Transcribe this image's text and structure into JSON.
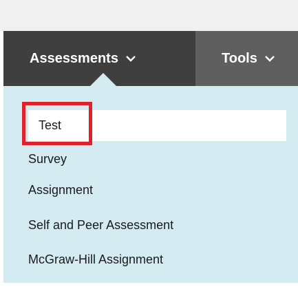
{
  "menubar": {
    "tabs": [
      {
        "label": "Assessments",
        "icon": "chevron-down-icon"
      },
      {
        "label": "Tools",
        "icon": "chevron-down-icon"
      }
    ]
  },
  "dropdown": {
    "items": [
      {
        "label": "Test",
        "selected": true
      },
      {
        "label": "Survey"
      },
      {
        "label": "Assignment"
      },
      {
        "label": "Self and Peer Assessment"
      },
      {
        "label": "McGraw-Hill Assignment"
      }
    ]
  },
  "colors": {
    "menubar_bg": "#5f5f5f",
    "active_tab_bg": "#3f3f3f",
    "dropdown_bg": "#d4ebf2",
    "highlight": "#e0202b"
  }
}
